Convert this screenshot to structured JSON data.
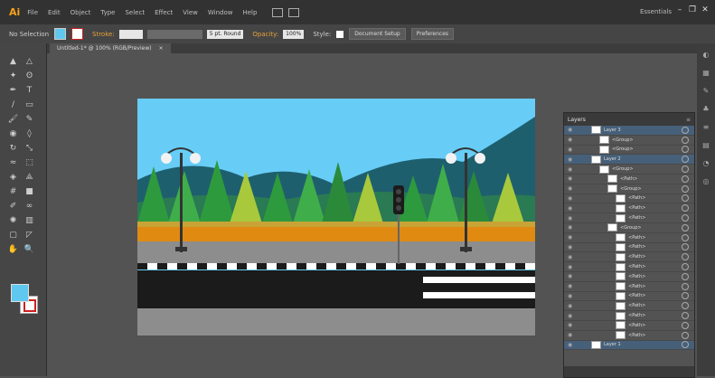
{
  "app": {
    "logo": "Ai",
    "workspace": "Essentials"
  },
  "menu": [
    "File",
    "Edit",
    "Object",
    "Type",
    "Select",
    "Effect",
    "View",
    "Window",
    "Help"
  ],
  "window_controls": [
    "–",
    "❐",
    "✕"
  ],
  "control_bar": {
    "selection_label": "No Selection",
    "stroke_label": "Stroke:",
    "brush_label": "5 pt. Round",
    "opacity_label": "Opacity:",
    "opacity_value": "100%",
    "style_label": "Style:",
    "doc_setup": "Document Setup",
    "preferences": "Preferences"
  },
  "document_tab": {
    "label": "Untitled-1* @ 100% (RGB/Preview)",
    "close": "×"
  },
  "colors": {
    "fill": "#60c8ee",
    "sky": "#67cdf6"
  },
  "tools": [
    "selection-icon",
    "direct-selection-icon",
    "magic-wand-icon",
    "lasso-icon",
    "pen-icon",
    "type-icon",
    "line-icon",
    "rectangle-icon",
    "paintbrush-icon",
    "pencil-icon",
    "blob-brush-icon",
    "eraser-icon",
    "rotate-icon",
    "scale-icon",
    "width-icon",
    "free-transform-icon",
    "shape-builder-icon",
    "perspective-icon",
    "mesh-icon",
    "gradient-icon",
    "eyedropper-icon",
    "blend-icon",
    "symbol-sprayer-icon",
    "graph-icon",
    "artboard-icon",
    "slice-icon",
    "hand-icon",
    "zoom-icon"
  ],
  "tool_glyphs": [
    "▲",
    "△",
    "✦",
    "ʘ",
    "✒",
    "T",
    "/",
    "▭",
    "🖌",
    "✎",
    "◉",
    "◊",
    "↻",
    "⤡",
    "≈",
    "⬚",
    "◈",
    "⟁",
    "#",
    "■",
    "✐",
    "∞",
    "✺",
    "▥",
    "▢",
    "◸",
    "✋",
    "🔍"
  ],
  "layers_panel": {
    "title": "Layers",
    "rows": [
      {
        "name": "Layer 3",
        "indent": 0
      },
      {
        "name": "<Group>",
        "indent": 1
      },
      {
        "name": "<Group>",
        "indent": 1
      },
      {
        "name": "Layer 2",
        "indent": 0
      },
      {
        "name": "<Group>",
        "indent": 1
      },
      {
        "name": "<Path>",
        "indent": 2
      },
      {
        "name": "<Group>",
        "indent": 2
      },
      {
        "name": "<Path>",
        "indent": 3
      },
      {
        "name": "<Path>",
        "indent": 3
      },
      {
        "name": "<Path>",
        "indent": 3
      },
      {
        "name": "<Group>",
        "indent": 2
      },
      {
        "name": "<Path>",
        "indent": 3
      },
      {
        "name": "<Path>",
        "indent": 3
      },
      {
        "name": "<Path>",
        "indent": 3
      },
      {
        "name": "<Path>",
        "indent": 3
      },
      {
        "name": "<Path>",
        "indent": 3
      },
      {
        "name": "<Path>",
        "indent": 3
      },
      {
        "name": "<Path>",
        "indent": 3
      },
      {
        "name": "<Path>",
        "indent": 3
      },
      {
        "name": "<Path>",
        "indent": 3
      },
      {
        "name": "<Path>",
        "indent": 3
      },
      {
        "name": "<Path>",
        "indent": 3
      },
      {
        "name": "Layer 1",
        "indent": 0
      }
    ]
  }
}
